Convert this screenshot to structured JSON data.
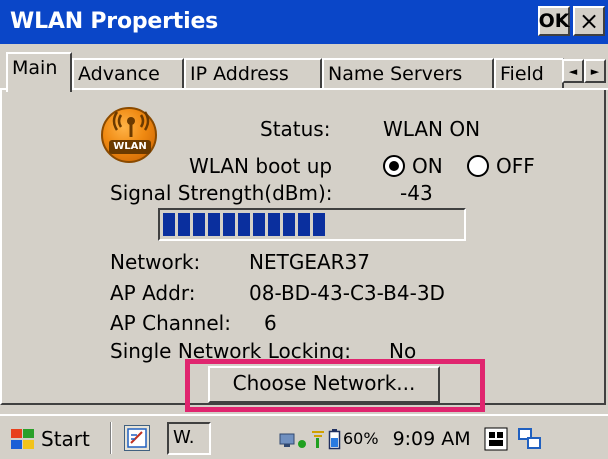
{
  "window": {
    "title": "WLAN Properties",
    "ok_label": "OK",
    "close_label": "×"
  },
  "tabs": [
    {
      "label": "Main",
      "active": true
    },
    {
      "label": "Advance",
      "active": false
    },
    {
      "label": "IP Address",
      "active": false
    },
    {
      "label": "Name Servers",
      "active": false
    },
    {
      "label": "Field",
      "active": false
    }
  ],
  "tab_scroll": {
    "left": "◄",
    "right": "►"
  },
  "main": {
    "icon_label": "WLAN",
    "status_label": "Status:",
    "status_value": "WLAN ON",
    "bootup_label": "WLAN boot up",
    "radio_on_label": "ON",
    "radio_off_label": "OFF",
    "bootup_selected": "ON",
    "signal_label": "Signal Strength(dBm):",
    "signal_value": "-43",
    "signal_bar_segments": 11,
    "network_label": "Network:",
    "network_value": "NETGEAR37",
    "ap_addr_label": "AP Addr:",
    "ap_addr_value": "08-BD-43-C3-B4-3D",
    "ap_channel_label": "AP Channel:",
    "ap_channel_value": "6",
    "locking_label": "Single Network Locking:",
    "locking_value": "No",
    "choose_button": "Choose Network..."
  },
  "taskbar": {
    "start_label": "Start",
    "task_label": "W.",
    "battery": "60%",
    "time": "9:09 AM"
  },
  "colors": {
    "titlebar": "#0a46c8",
    "highlight": "#e0256f",
    "progress": "#0a2f9e"
  }
}
